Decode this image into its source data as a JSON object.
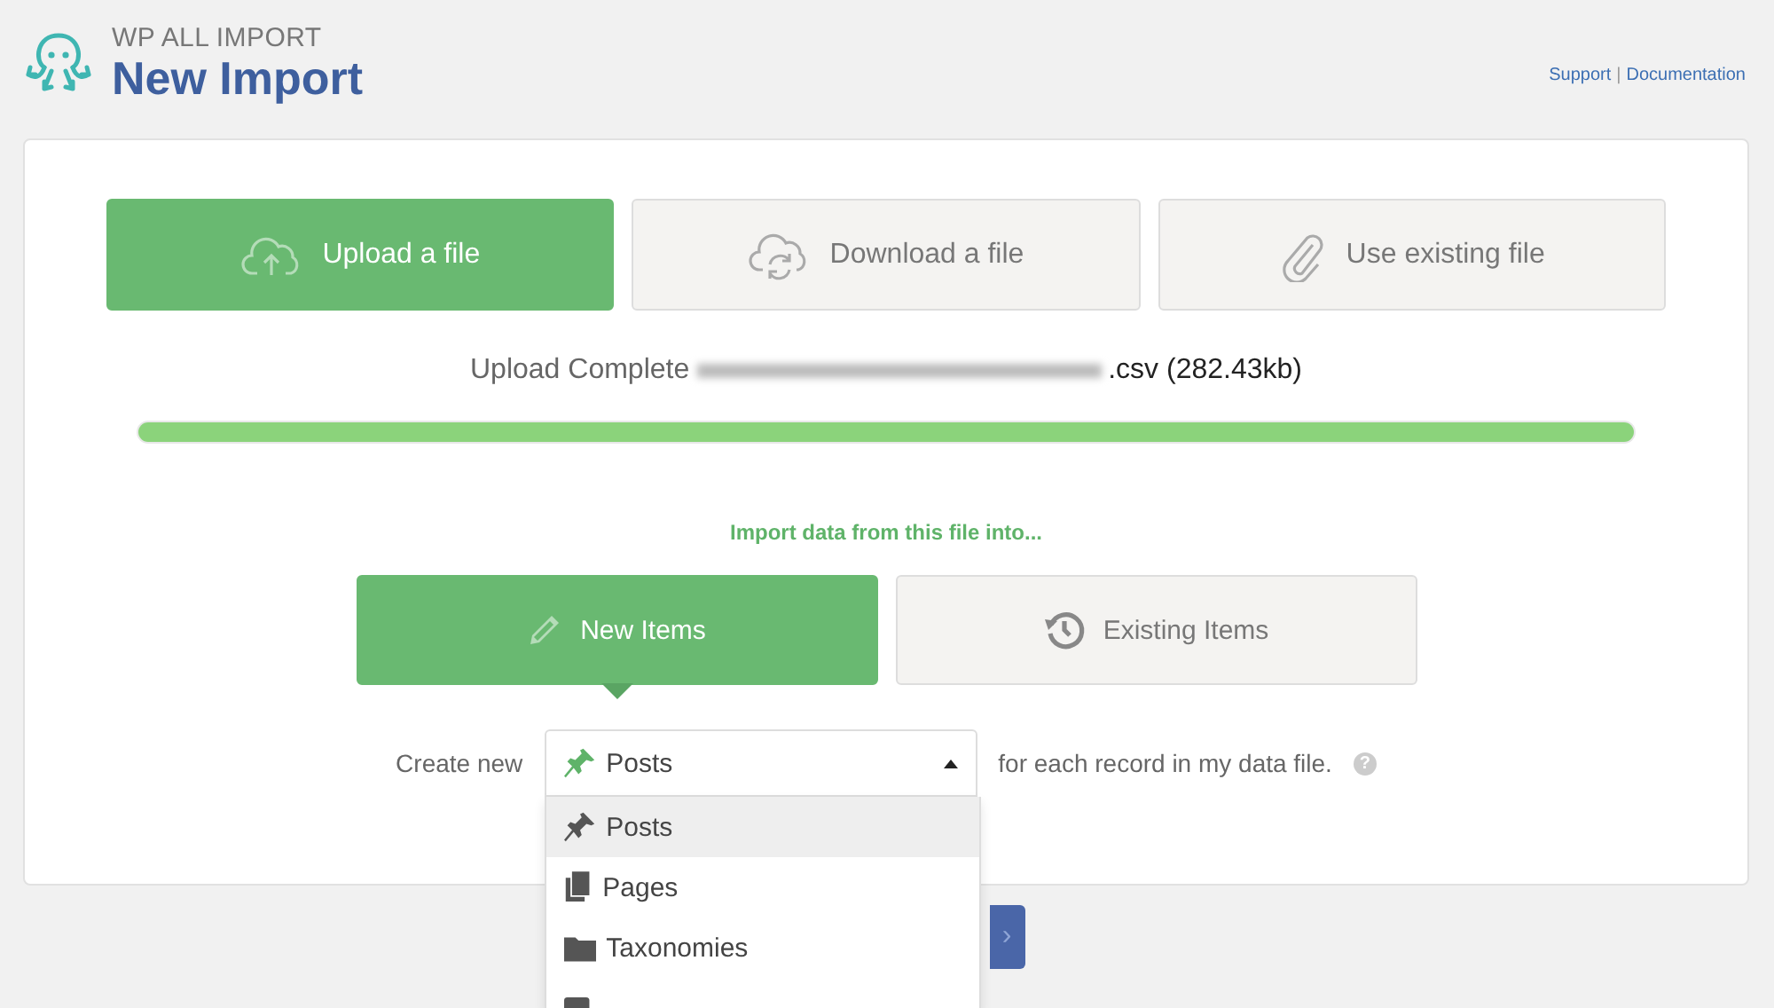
{
  "header": {
    "brand": "WP ALL IMPORT",
    "title": "New Import",
    "links": [
      {
        "label": "Support"
      },
      {
        "label": "Documentation"
      }
    ],
    "separator": "|"
  },
  "source_tabs": [
    {
      "label": "Upload a file",
      "kind": "upload",
      "selected": true
    },
    {
      "label": "Download a file",
      "kind": "download",
      "selected": false
    },
    {
      "label": "Use existing file",
      "kind": "existing",
      "selected": false
    }
  ],
  "upload": {
    "status": "Upload Complete",
    "file_suffix": ".csv (282.43kb)",
    "level": 1
  },
  "import_prompt": "Import data from this file into...",
  "target_tabs": [
    {
      "label": "New Items",
      "kind": "new",
      "selected": true
    },
    {
      "label": "Existing Items",
      "kind": "existing",
      "selected": false
    }
  ],
  "create_row": {
    "prefix": "Create new",
    "suffix": "for each record in my data file.",
    "help": "?",
    "select": {
      "value": "Posts",
      "expanded": true,
      "options": [
        {
          "label": "Posts",
          "kind": "posts",
          "selected": true
        },
        {
          "label": "Pages",
          "kind": "pages",
          "selected": false
        },
        {
          "label": "Taxonomies",
          "kind": "taxonomies",
          "selected": false
        }
      ]
    }
  },
  "continue_button": "›"
}
